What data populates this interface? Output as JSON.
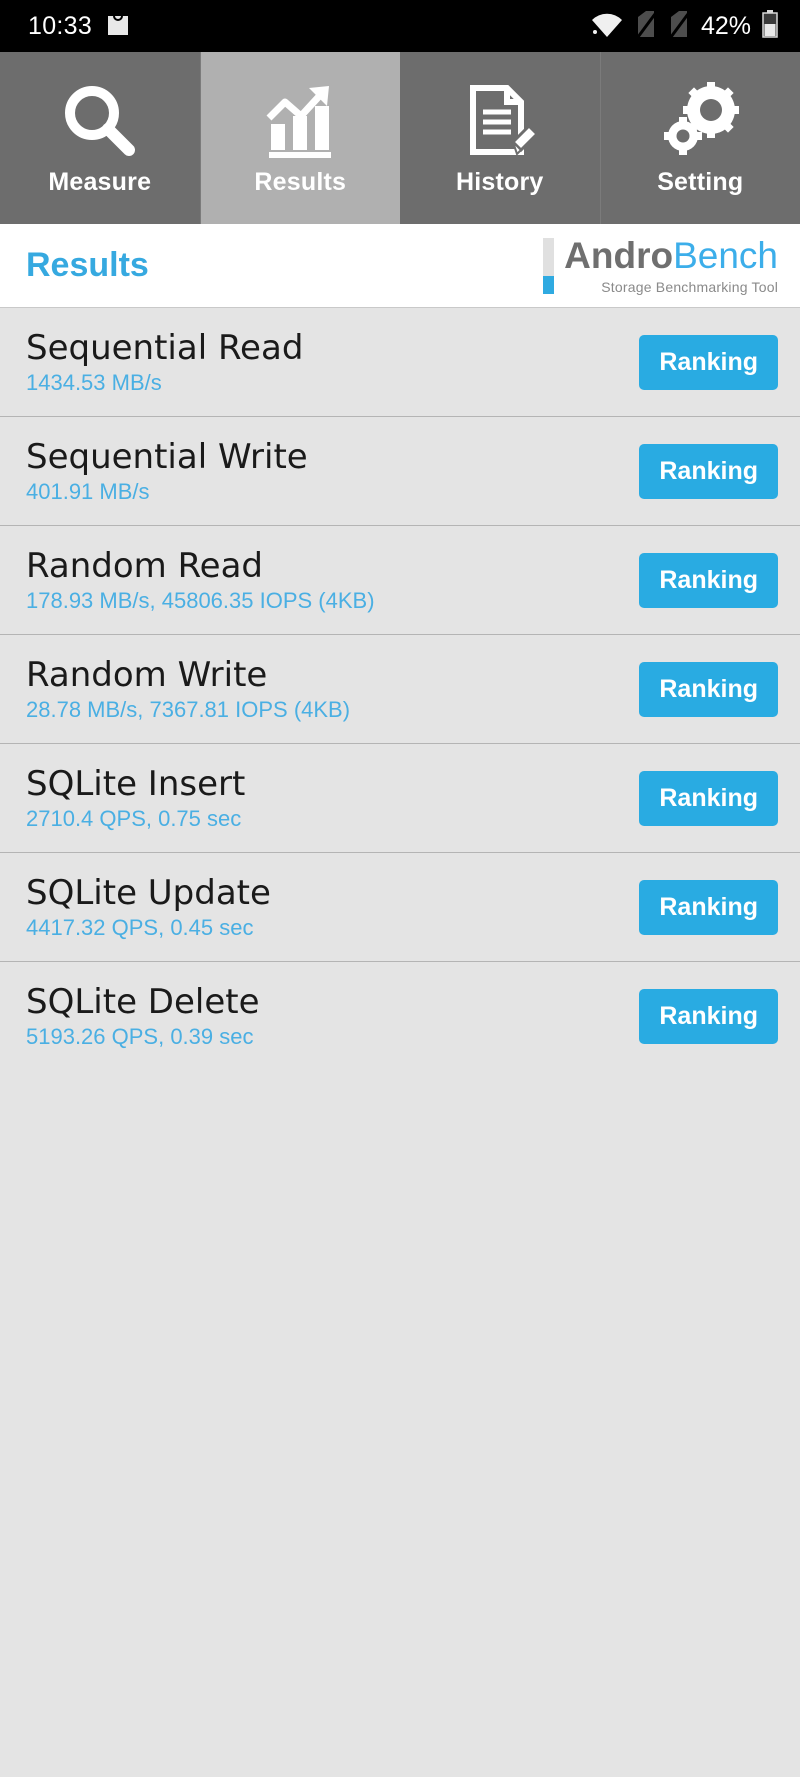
{
  "status_bar": {
    "time": "10:33",
    "battery_percent": "42%",
    "icons": [
      "shopping-bag-icon",
      "wifi-icon",
      "no-sim-1-icon",
      "no-sim-2-icon",
      "battery-icon"
    ]
  },
  "tabs": [
    {
      "label": "Measure",
      "icon": "magnifier-icon",
      "selected": false
    },
    {
      "label": "Results",
      "icon": "bar-chart-icon",
      "selected": true
    },
    {
      "label": "History",
      "icon": "document-pencil-icon",
      "selected": false
    },
    {
      "label": "Setting",
      "icon": "gears-icon",
      "selected": false
    }
  ],
  "header": {
    "title": "Results",
    "brand_first": "Andro",
    "brand_second": "Bench",
    "tagline": "Storage Benchmarking Tool"
  },
  "results": [
    {
      "name": "Sequential Read",
      "value": "1434.53 MB/s",
      "button": "Ranking"
    },
    {
      "name": "Sequential Write",
      "value": "401.91 MB/s",
      "button": "Ranking"
    },
    {
      "name": "Random Read",
      "value": "178.93 MB/s, 45806.35 IOPS (4KB)",
      "button": "Ranking"
    },
    {
      "name": "Random Write",
      "value": "28.78 MB/s, 7367.81 IOPS (4KB)",
      "button": "Ranking"
    },
    {
      "name": "SQLite Insert",
      "value": "2710.4 QPS, 0.75 sec",
      "button": "Ranking"
    },
    {
      "name": "SQLite Update",
      "value": "4417.32 QPS, 0.45 sec",
      "button": "Ranking"
    },
    {
      "name": "SQLite Delete",
      "value": "5193.26 QPS, 0.39 sec",
      "button": "Ranking"
    }
  ],
  "colors": {
    "accent_blue": "#29abe2",
    "value_blue": "#4aafe3",
    "title_blue": "#36a9e0",
    "tab_bg": "#6d6d6d",
    "tab_selected_bg": "#b0b0b0",
    "row_bg": "#e4e4e4"
  }
}
